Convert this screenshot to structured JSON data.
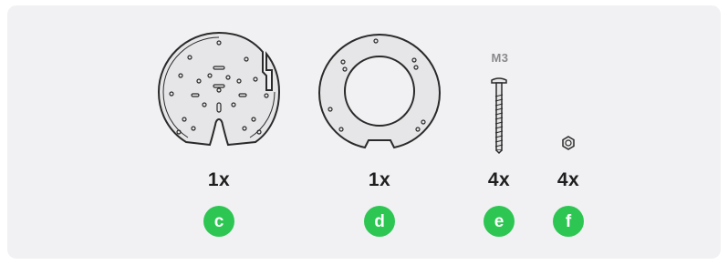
{
  "items": [
    {
      "name": "plate",
      "quantity": "1x",
      "letter": "c"
    },
    {
      "name": "ring",
      "quantity": "1x",
      "letter": "d"
    },
    {
      "name": "screw",
      "quantity": "4x",
      "letter": "e",
      "size_label": "M3"
    },
    {
      "name": "nut",
      "quantity": "4x",
      "letter": "f"
    }
  ],
  "colors": {
    "badge": "#2dc653",
    "panel": "#f1f1f3",
    "part_fill": "#e6e6e8",
    "outline": "#2a2a2a"
  }
}
